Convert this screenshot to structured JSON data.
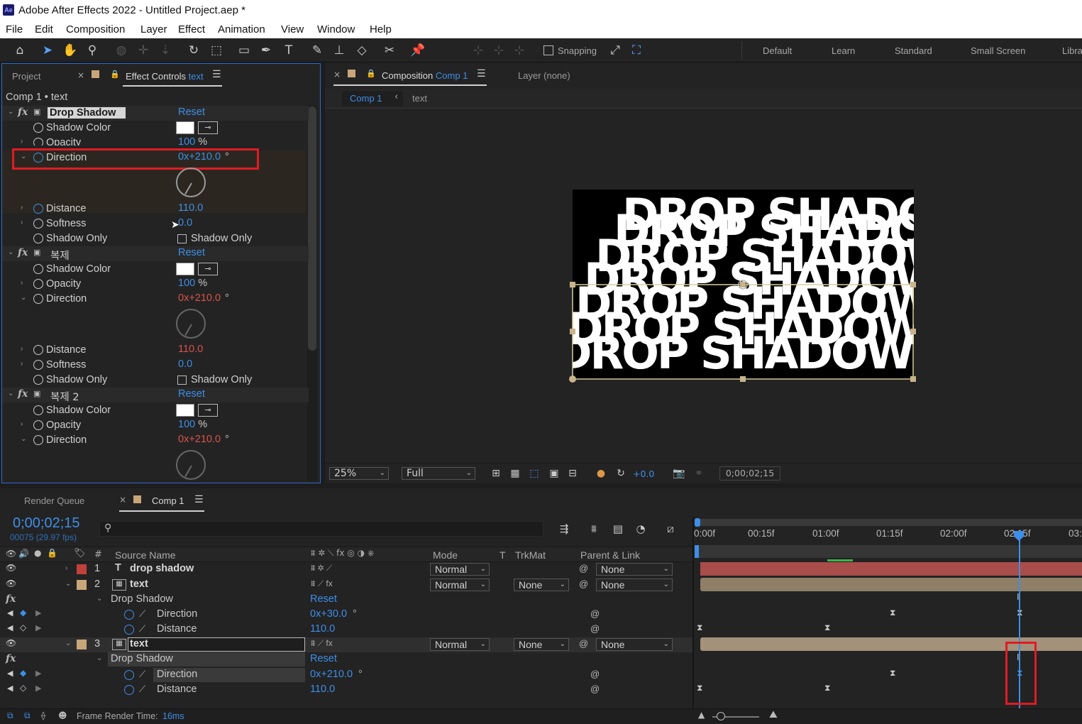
{
  "app": {
    "title": "Adobe After Effects 2022 - Untitled Project.aep *",
    "icon_text": "Ae"
  },
  "menu": [
    "File",
    "Edit",
    "Composition",
    "Layer",
    "Effect",
    "Animation",
    "View",
    "Window",
    "Help"
  ],
  "toolbar": {
    "snapping_label": "Snapping",
    "workspaces": [
      "Default",
      "Learn",
      "Standard",
      "Small Screen",
      "Libra"
    ]
  },
  "left_panel": {
    "tab_project": "Project",
    "tab_effect_controls": "Effect Controls",
    "tab_effect_controls_layer": "text",
    "breadcrumb": "Comp 1 • text",
    "effects": [
      {
        "name": "Drop Shadow",
        "reset": "Reset",
        "shadow_color": "Shadow Color",
        "opacity_label": "Opacity",
        "opacity": "100",
        "opacity_unit": "%",
        "direction_label": "Direction",
        "direction": "0x+210.0",
        "direction_unit": "°",
        "distance_label": "Distance",
        "distance": "110.0",
        "softness_label": "Softness",
        "softness": "0.0",
        "shadow_only_label": "Shadow Only",
        "shadow_only_check": "Shadow Only"
      },
      {
        "name": "복제",
        "reset": "Reset",
        "shadow_color": "Shadow Color",
        "opacity_label": "Opacity",
        "opacity": "100",
        "opacity_unit": "%",
        "direction_label": "Direction",
        "direction": "0x+210.0",
        "direction_unit": "°",
        "distance_label": "Distance",
        "distance": "110.0",
        "softness_label": "Softness",
        "softness": "0.0",
        "shadow_only_label": "Shadow Only",
        "shadow_only_check": "Shadow Only"
      },
      {
        "name": "복제 2",
        "reset": "Reset",
        "shadow_color": "Shadow Color",
        "opacity_label": "Opacity",
        "opacity": "100",
        "opacity_unit": "%",
        "direction_label": "Direction",
        "direction": "0x+210.0",
        "direction_unit": "°"
      }
    ]
  },
  "comp_panel": {
    "tab_label": "Composition",
    "tab_comp": "Comp 1",
    "layer_tab": "Layer (none)",
    "nav_comp": "Comp 1",
    "nav_layer": "text",
    "canvas_text": "DROP SHADOW",
    "zoom": "25%",
    "resolution": "Full",
    "exposure": "+0.0",
    "timecode": "0;00;02;15"
  },
  "timeline": {
    "tab_render_queue": "Render Queue",
    "tab_comp": "Comp 1",
    "timecode": "0;00;02;15",
    "frame_info": "00075 (29.97 fps)",
    "columns": {
      "hash": "#",
      "source_name": "Source Name",
      "mode": "Mode",
      "t": "T",
      "trkmat": "TrkMat",
      "parent": "Parent & Link"
    },
    "ruler": [
      "0:00f",
      "00:15f",
      "01:00f",
      "01:15f",
      "02:00f",
      "02:15f",
      "03:"
    ],
    "layers": [
      {
        "num": "1",
        "type_icon": "T",
        "name": "drop shadow",
        "mode": "Normal",
        "trkmat": "",
        "parent": "None",
        "color": "#c0413b"
      },
      {
        "num": "2",
        "name": "text",
        "mode": "Normal",
        "trkmat": "None",
        "parent": "None",
        "color": "#c8a679",
        "effect": "Drop Shadow",
        "reset": "Reset",
        "props": [
          {
            "name": "Direction",
            "value": "0x+30.0",
            "unit": "°"
          },
          {
            "name": "Distance",
            "value": "110.0",
            "unit": ""
          }
        ]
      },
      {
        "num": "3",
        "name": "text",
        "mode": "Normal",
        "trkmat": "None",
        "parent": "None",
        "color": "#c8a679",
        "effect": "Drop Shadow",
        "reset": "Reset",
        "props": [
          {
            "name": "Direction",
            "value": "0x+210.0",
            "unit": "°"
          },
          {
            "name": "Distance",
            "value": "110.0",
            "unit": ""
          }
        ]
      }
    ],
    "status_label": "Frame Render Time:",
    "status_value": "16ms"
  },
  "colors": {
    "accent_blue": "#3d8ee8",
    "highlight_red": "#e01b24",
    "panel_bg": "#232323"
  }
}
